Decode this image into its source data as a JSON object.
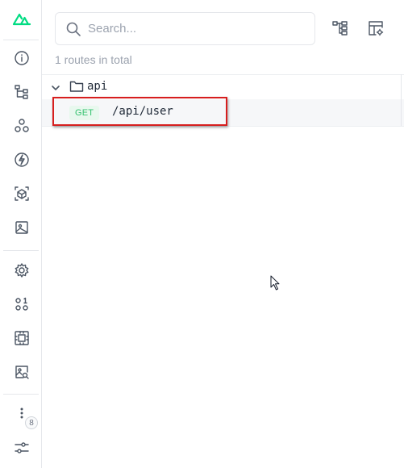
{
  "search": {
    "placeholder": "Search..."
  },
  "summary": {
    "text": "1 routes in total"
  },
  "tree": {
    "folder": {
      "name": "api"
    },
    "route": {
      "method": "GET",
      "path": "/api/user"
    }
  },
  "sidebar": {
    "badge_count": "8",
    "items": [
      {
        "icon": "nuxt-logo-icon"
      },
      {
        "icon": "info-icon"
      },
      {
        "icon": "components-tree-icon"
      },
      {
        "icon": "modules-icon"
      },
      {
        "icon": "lightning-icon"
      },
      {
        "icon": "cube-icon"
      },
      {
        "icon": "image-icon"
      },
      {
        "icon": "gear-icon"
      },
      {
        "icon": "shapes-icon"
      },
      {
        "icon": "chip-icon"
      },
      {
        "icon": "image-search-icon"
      },
      {
        "icon": "more-icon"
      },
      {
        "icon": "settings-sliders-icon"
      }
    ]
  },
  "colors": {
    "accent": "#00dc82",
    "get_method_text": "#34c26f",
    "get_method_bg": "#e8f8ee",
    "highlight_border": "#d71e1e"
  }
}
